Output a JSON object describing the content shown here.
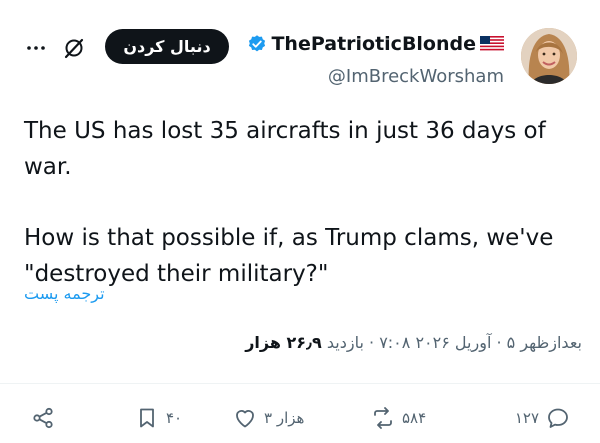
{
  "author": {
    "display_name": "ThePatrioticBlonde",
    "handle": "@ImBreckWorsham",
    "flag_emoji": "🇺🇸"
  },
  "header": {
    "follow_label": "دنبال کردن"
  },
  "tweet": {
    "line1": "The US has lost 35 aircrafts in just 36 days of war.",
    "line2": "How is that possible if, as Trump clams, we've \"destroyed their military?\"",
    "translate_label": "ترجمه پست"
  },
  "meta": {
    "datetime": "بعدازظهر ۵ · آوریل ۲۰۲۶ ۷:۰۸ · بازدید",
    "views": "۲۶٫۹ هزار"
  },
  "actions": {
    "replies": "۱۲۷",
    "reposts": "۵۸۴",
    "likes": "۳ هزار",
    "bookmarks": "۴۰"
  },
  "colors": {
    "accent": "#1d9bf0",
    "verified": "#1d9bf0",
    "text": "#0f1419",
    "muted": "#536471"
  }
}
